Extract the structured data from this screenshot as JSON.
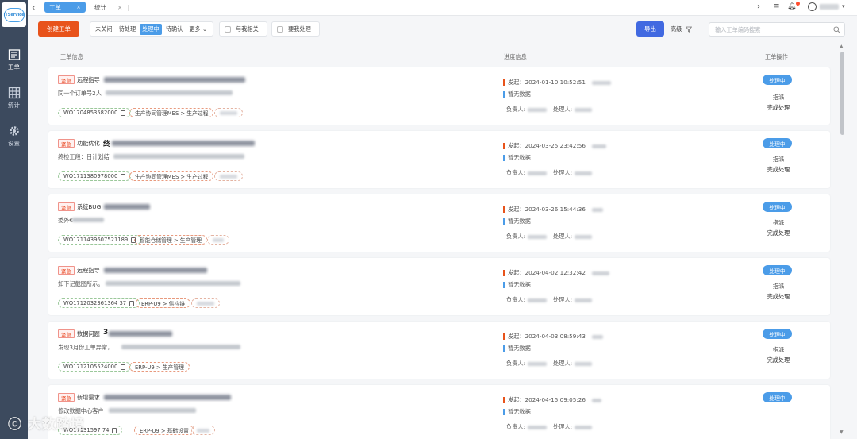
{
  "app": {
    "logo_text": "ITService"
  },
  "sidebar": {
    "items": [
      {
        "label": "工单",
        "icon": "ticket-icon"
      },
      {
        "label": "统计",
        "icon": "grid-icon"
      },
      {
        "label": "设置",
        "icon": "gear-icon"
      }
    ]
  },
  "tabs": [
    {
      "label": "工单",
      "active": true
    },
    {
      "label": "统计",
      "active": false
    }
  ],
  "toolbar": {
    "create_label": "创建工单",
    "filters": [
      "未关闭",
      "待处理",
      "处理中",
      "待确认",
      "更多"
    ],
    "active_filter": "处理中",
    "related_label": "与我相关",
    "my_process_label": "要我处理",
    "export_label": "导出",
    "advanced_label": "高级",
    "search_placeholder": "输入工单编码搜索"
  },
  "columns": {
    "info": "工单信息",
    "progress": "进度信息",
    "ops": "工单操作"
  },
  "labels": {
    "urgent": "紧急",
    "no_data": "暂无数据",
    "owner": "负责人:",
    "handler": "处理人:",
    "status": "处理中",
    "op_dispatch": "指派",
    "op_complete": "完成处理"
  },
  "tickets": [
    {
      "type": "远程指导",
      "first_char": "",
      "desc": "同一个订单号2人",
      "id": "WO1704853582000",
      "category": "生产协同管理MES > 生产过程",
      "time": "发起：2024-01-10 10:52:51"
    },
    {
      "type": "功能优化",
      "first_char": "终",
      "desc": "终检工段：日计划结",
      "id": "WO1711380978000",
      "category": "生产协同管理MES > 生产过程",
      "time": "发起：2024-03-25 23:42:56"
    },
    {
      "type": "系统BUG",
      "first_char": "",
      "desc": "委外€",
      "id": "WO1711439607521189",
      "category": "智能仓储管理 > 生产管理",
      "time": "发起：2024-03-26 15:44:36"
    },
    {
      "type": "远程指导",
      "first_char": "",
      "desc": "如下记截图所示。",
      "id": "WO1712032361364 37",
      "category": "ERP-U9 > 供应链",
      "time": "发起：2024-04-02 12:32:42"
    },
    {
      "type": "数据问题",
      "first_char": "3",
      "desc": "发现3月份工单异常，",
      "id": "WO1712105524000",
      "category": "ERP-U9 > 生产管理",
      "time": "发起：2024-04-03 08:59:43"
    },
    {
      "type": "新增需求",
      "first_char": "",
      "desc": "修改数据中心客户",
      "id": "WO17131597 74",
      "category": "ERP-U9 > 基础设置",
      "time": "发起：2024-04-15 09:05:26"
    }
  ],
  "watermark": "大数踏境"
}
